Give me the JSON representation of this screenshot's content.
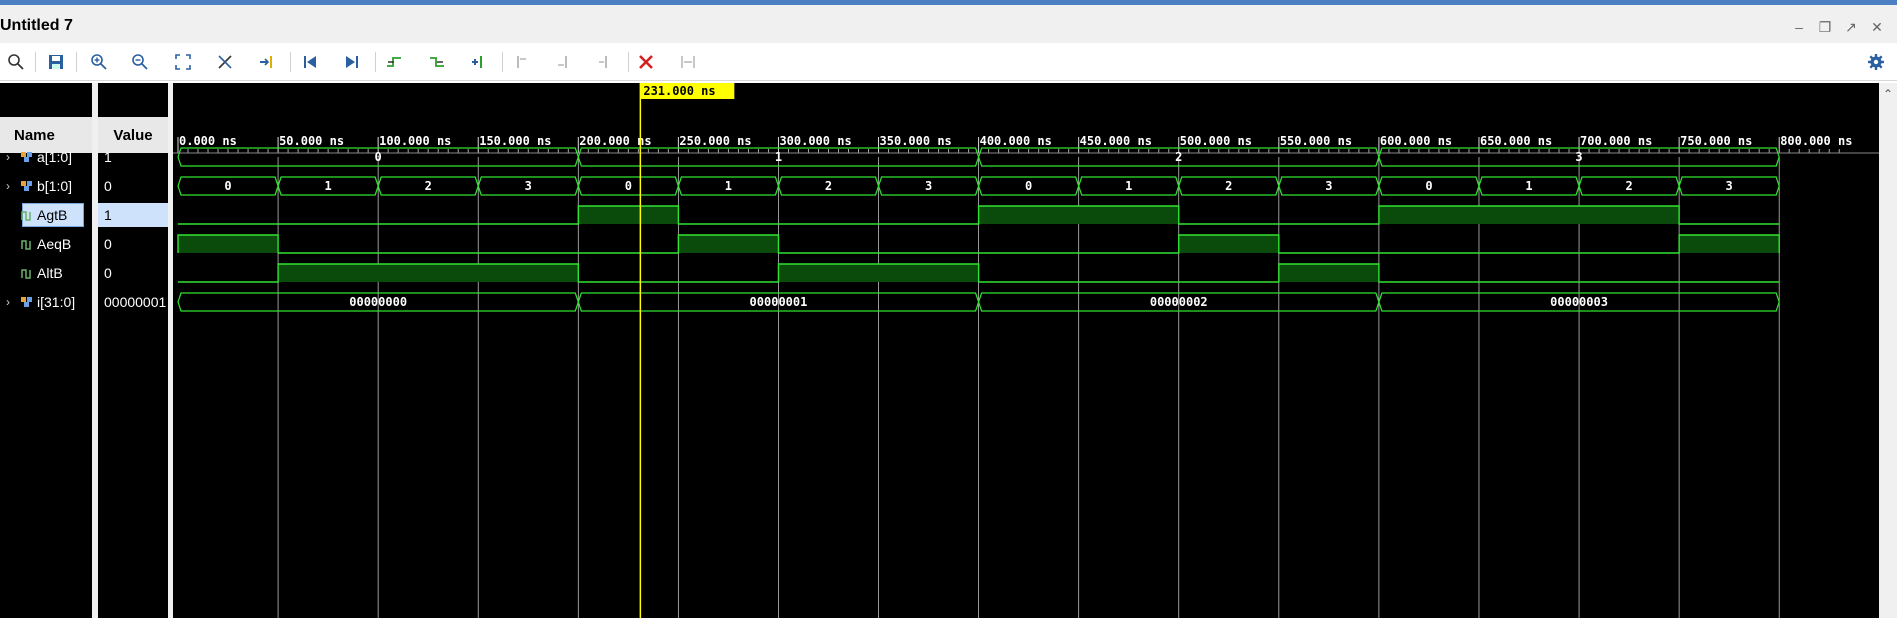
{
  "window": {
    "title": "Untitled 7"
  },
  "cursor": {
    "label": "231.000 ns",
    "time_ns": 231
  },
  "columns": {
    "name_header": "Name",
    "value_header": "Value"
  },
  "timescale": {
    "unit": "ns",
    "tick_labels": [
      "0.000 ns",
      "50.000 ns",
      "100.000 ns",
      "150.000 ns",
      "200.000 ns",
      "250.000 ns",
      "300.000 ns",
      "350.000 ns",
      "400.000 ns",
      "450.000 ns",
      "500.000 ns",
      "550.000 ns",
      "600.000 ns",
      "650.000 ns",
      "700.000 ns",
      "750.000 ns",
      "800.000 ns"
    ]
  },
  "signals": [
    {
      "name": "a[1:0]",
      "value": "1",
      "type": "bus",
      "expandable": true,
      "icon": "bus-icon",
      "segments": [
        {
          "start": 0,
          "end": 200,
          "label": "0"
        },
        {
          "start": 200,
          "end": 400,
          "label": "1"
        },
        {
          "start": 400,
          "end": 600,
          "label": "2"
        },
        {
          "start": 600,
          "end": 800,
          "label": "3"
        }
      ]
    },
    {
      "name": "b[1:0]",
      "value": "0",
      "type": "bus",
      "expandable": true,
      "icon": "bus-icon",
      "segments": [
        {
          "start": 0,
          "end": 50,
          "label": "0"
        },
        {
          "start": 50,
          "end": 100,
          "label": "1"
        },
        {
          "start": 100,
          "end": 150,
          "label": "2"
        },
        {
          "start": 150,
          "end": 200,
          "label": "3"
        },
        {
          "start": 200,
          "end": 250,
          "label": "0"
        },
        {
          "start": 250,
          "end": 300,
          "label": "1"
        },
        {
          "start": 300,
          "end": 350,
          "label": "2"
        },
        {
          "start": 350,
          "end": 400,
          "label": "3"
        },
        {
          "start": 400,
          "end": 450,
          "label": "0"
        },
        {
          "start": 450,
          "end": 500,
          "label": "1"
        },
        {
          "start": 500,
          "end": 550,
          "label": "2"
        },
        {
          "start": 550,
          "end": 600,
          "label": "3"
        },
        {
          "start": 600,
          "end": 650,
          "label": "0"
        },
        {
          "start": 650,
          "end": 700,
          "label": "1"
        },
        {
          "start": 700,
          "end": 750,
          "label": "2"
        },
        {
          "start": 750,
          "end": 800,
          "label": "3"
        }
      ]
    },
    {
      "name": "AgtB",
      "value": "1",
      "type": "bit",
      "expandable": false,
      "icon": "bit-signal-icon",
      "selected": true,
      "high": [
        [
          200,
          250
        ],
        [
          400,
          500
        ],
        [
          600,
          750
        ]
      ]
    },
    {
      "name": "AeqB",
      "value": "0",
      "type": "bit",
      "expandable": false,
      "icon": "bit-signal-icon",
      "high": [
        [
          0,
          50
        ],
        [
          250,
          300
        ],
        [
          500,
          550
        ],
        [
          750,
          800
        ]
      ]
    },
    {
      "name": "AltB",
      "value": "0",
      "type": "bit",
      "expandable": false,
      "icon": "bit-signal-icon",
      "high": [
        [
          50,
          200
        ],
        [
          300,
          400
        ],
        [
          550,
          600
        ]
      ]
    },
    {
      "name": "i[31:0]",
      "value": "00000001",
      "type": "bus",
      "expandable": true,
      "icon": "bus-icon",
      "segments": [
        {
          "start": 0,
          "end": 200,
          "label": "00000000"
        },
        {
          "start": 200,
          "end": 400,
          "label": "00000001"
        },
        {
          "start": 400,
          "end": 600,
          "label": "00000002"
        },
        {
          "start": 600,
          "end": 800,
          "label": "00000003"
        }
      ]
    }
  ],
  "toolbar": [
    "search-icon",
    "save-icon",
    "zoom-in-icon",
    "zoom-out-icon",
    "zoom-fit-icon",
    "cursor-snap-icon",
    "go-to-time-icon",
    "go-to-start-icon",
    "go-to-end-icon",
    "previous-transition-icon",
    "next-transition-icon",
    "add-marker-icon",
    "previous-marker-icon",
    "next-marker-icon",
    "delete-marker-icon",
    "close-red-icon",
    "swap-cursors-icon",
    "settings-gear-icon"
  ],
  "colors": {
    "wave": "#31e331",
    "wave_fill": "#0a4a0a",
    "cursor": "#ffff00",
    "grid": "#bfbfbf"
  }
}
